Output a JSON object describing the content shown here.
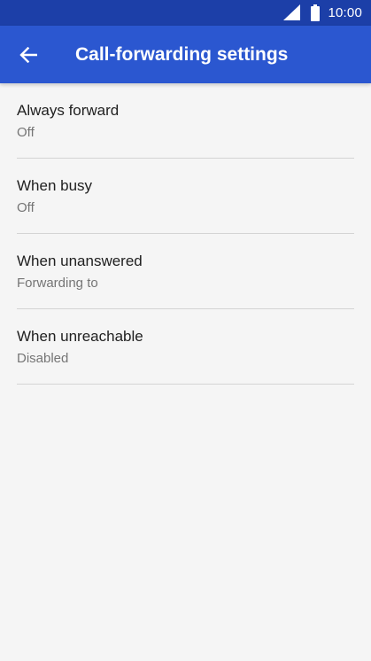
{
  "status_bar": {
    "time": "10:00",
    "icons": [
      "signal-icon",
      "battery-icon"
    ]
  },
  "app_bar": {
    "title": "Call-forwarding settings",
    "back_icon": "arrow-back-icon"
  },
  "colors": {
    "status_bar": "#1c3fa8",
    "app_bar": "#2b57d0",
    "background": "#f5f5f5",
    "title_text": "#212121",
    "summary_text": "#757575",
    "divider": "#d4d4d4"
  },
  "settings": {
    "items": [
      {
        "title": "Always forward",
        "summary": "Off"
      },
      {
        "title": "When busy",
        "summary": "Off"
      },
      {
        "title": "When unanswered",
        "summary": "Forwarding to"
      },
      {
        "title": "When unreachable",
        "summary": "Disabled"
      }
    ]
  }
}
